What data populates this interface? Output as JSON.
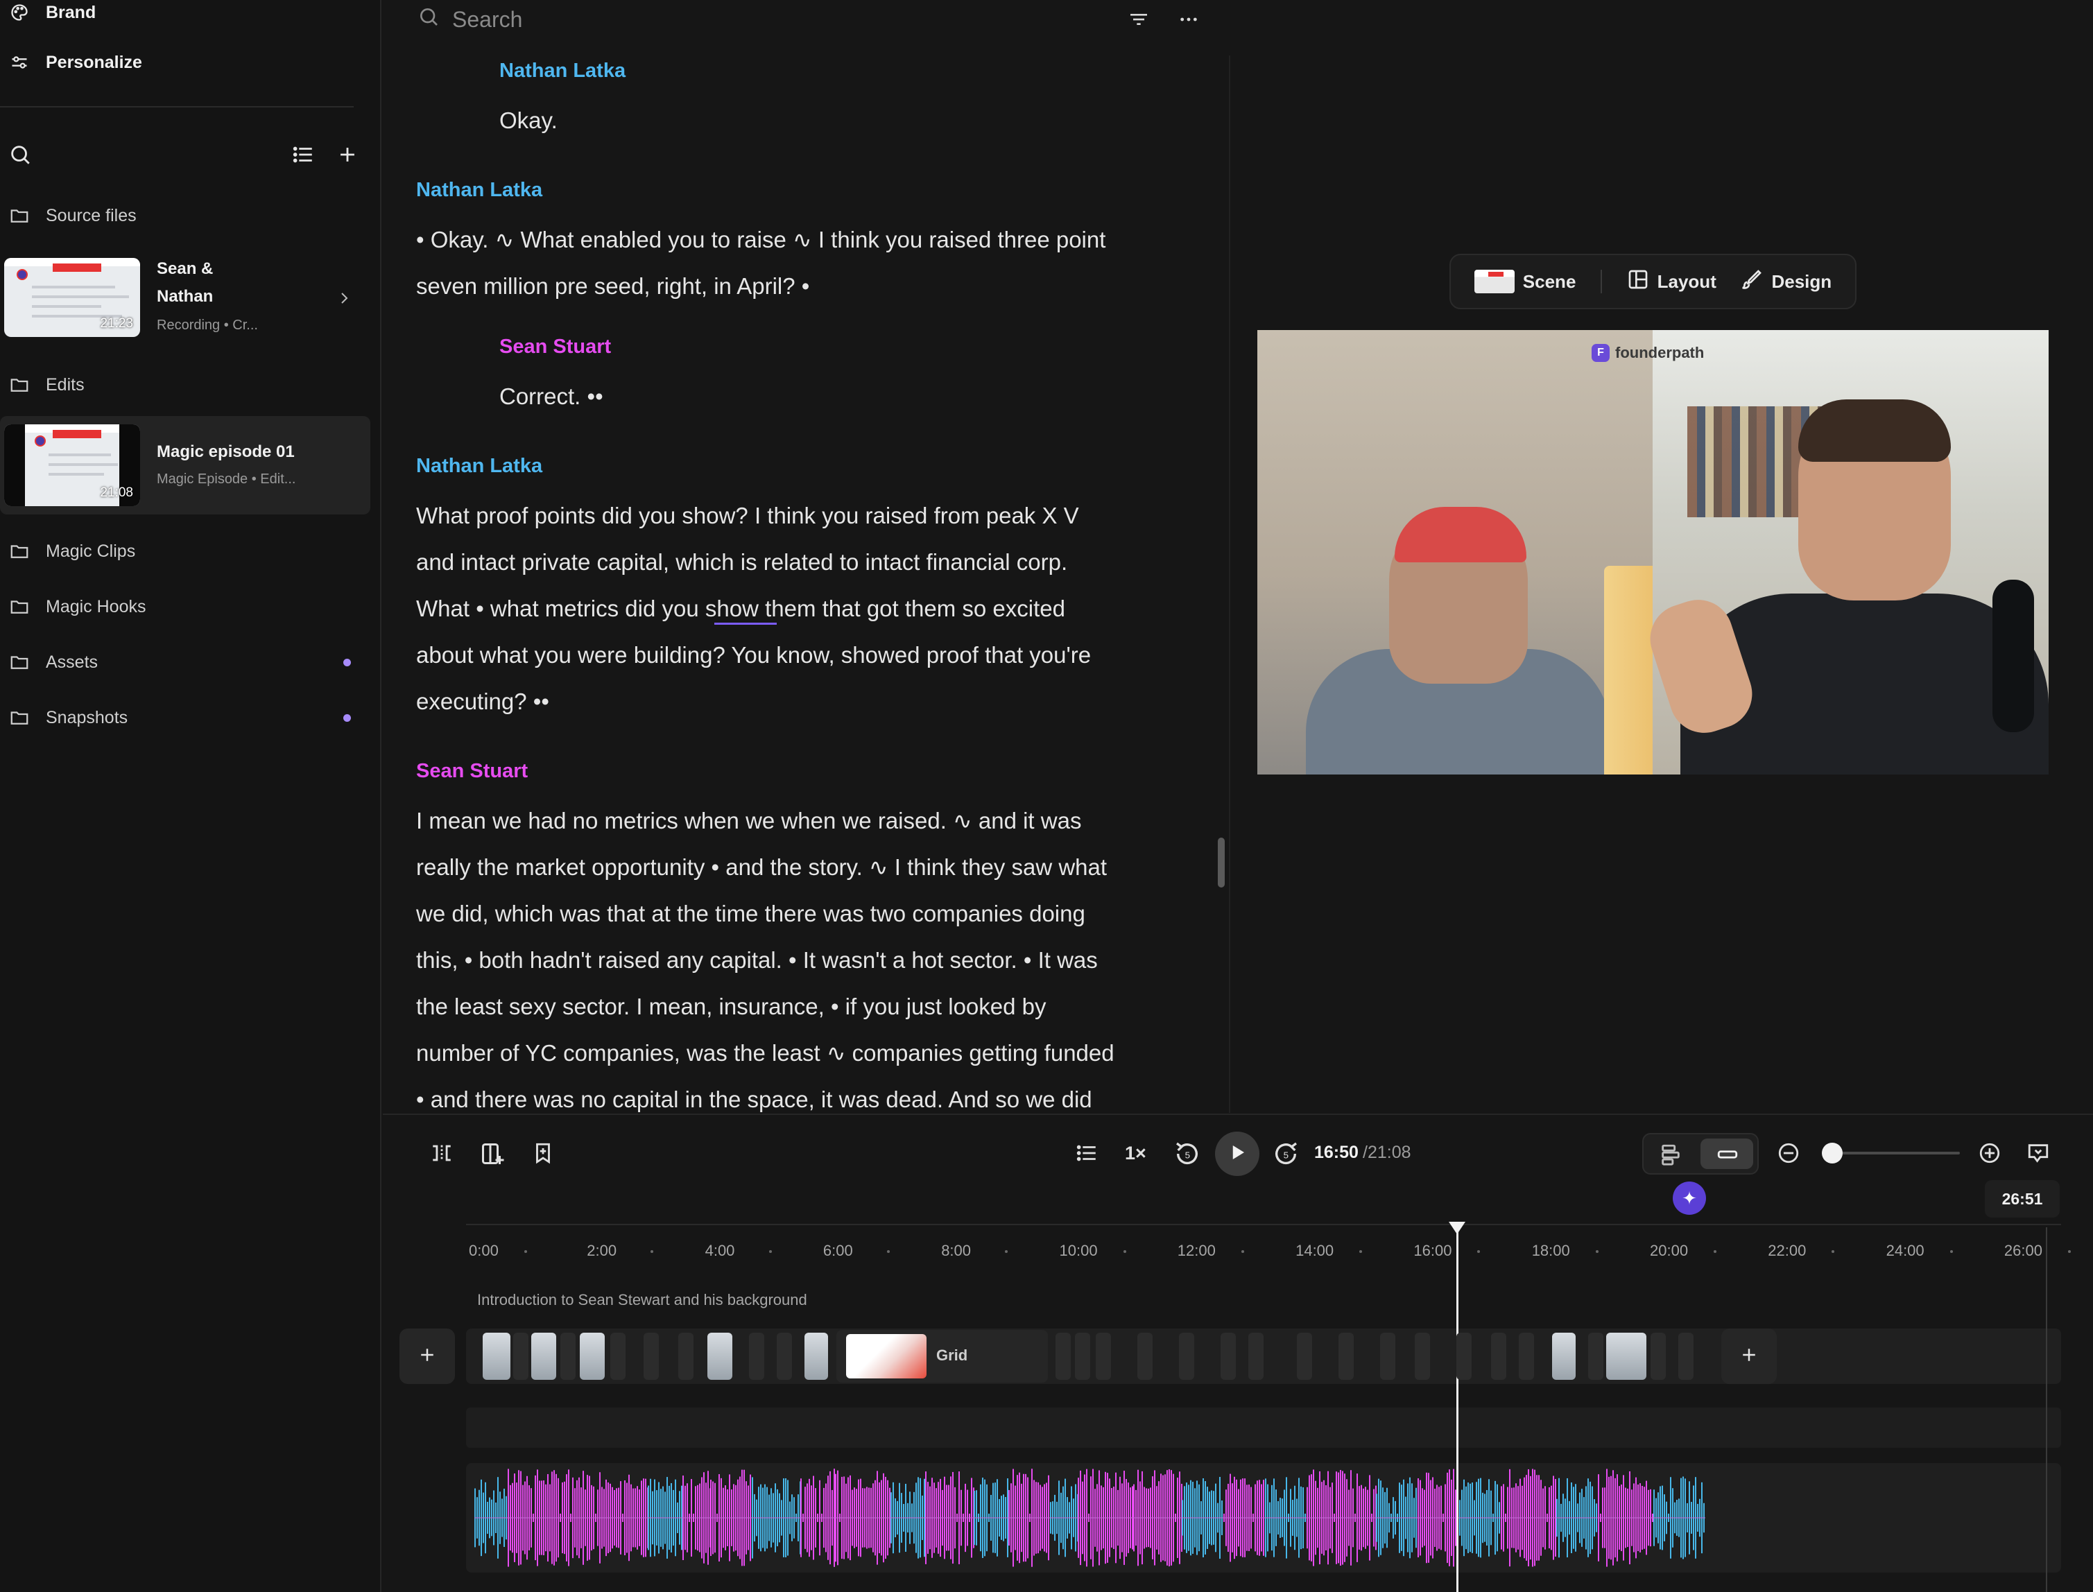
{
  "sidebar": {
    "brand_label": "Brand",
    "personalize_label": "Personalize",
    "source_files_label": "Source files",
    "source_item": {
      "title_line1": "Sean &",
      "title_line2": "Nathan",
      "subtitle": "Recording • Cr...",
      "duration": "21:23"
    },
    "edits_label": "Edits",
    "edit_item": {
      "title": "Magic episode 01",
      "subtitle": "Magic Episode • Edit...",
      "duration": "21:08"
    },
    "folders": [
      {
        "label": "Magic Clips",
        "has_dot": false
      },
      {
        "label": "Magic Hooks",
        "has_dot": false
      },
      {
        "label": "Assets",
        "has_dot": true
      },
      {
        "label": "Snapshots",
        "has_dot": true
      }
    ]
  },
  "transcript": {
    "search_placeholder": "Search",
    "blocks": [
      {
        "speaker": "Nathan Latka",
        "lines": [
          "Okay."
        ]
      },
      {
        "speaker": "Nathan Latka",
        "lines": [
          "• Okay. ∿ What enabled you to raise ∿ I think you raised three point",
          "seven million pre seed, right, in April? •"
        ]
      },
      {
        "speaker": "Sean Stuart",
        "lines": [
          "Correct. ••"
        ]
      },
      {
        "speaker": "Nathan Latka",
        "lines": [
          "What proof points did you show? I think you raised from peak X V",
          "and intact private capital, which is related to intact financial corp.",
          "What • what metrics did you show them that got them so excited",
          "about what you were building? You know, showed proof that you're",
          "executing? ••"
        ]
      },
      {
        "speaker": "Sean Stuart",
        "lines": [
          "I mean we had no metrics when we when we raised. ∿ and it was",
          "really the market opportunity • and the story. ∿ I think they saw what",
          "we did, which was that at the time there was two companies doing",
          "this, • both hadn't raised any capital. • It wasn't a hot sector. • It was",
          "the least sexy sector. I mean, insurance, • if you just looked by",
          "number of YC companies, was the least ∿ companies getting funded",
          "• and there was no capital in the space, it was dead. And so we did"
        ]
      }
    ]
  },
  "preview": {
    "toolbar": {
      "scene_label": "Scene",
      "layout_label": "Layout",
      "design_label": "Design"
    },
    "brand_tag": "founderpath",
    "brand_tag_icon": "F"
  },
  "controls": {
    "speed": "1×",
    "current_time": "16:50",
    "total_time": "/21:08",
    "duration_chip": "26:51",
    "zoom_level": 0.05
  },
  "timeline": {
    "ticks": [
      "0:00",
      "2:00",
      "4:00",
      "6:00",
      "8:00",
      "10:00",
      "12:00",
      "14:00",
      "16:00",
      "18:00",
      "20:00",
      "22:00",
      "24:00",
      "26:00"
    ],
    "chapter_title": "Introduction to Sean Stewart and his background",
    "grid_clip_label": "Grid",
    "playhead_time": "16:50",
    "waveform_colors": {
      "speaker_a": "#e64cf0",
      "speaker_b": "#48b8ea"
    }
  },
  "colors": {
    "accent": "#7c5cff",
    "speaker_nathan": "#4fb7f0",
    "speaker_sean": "#e64cf0",
    "background": "#161616"
  }
}
